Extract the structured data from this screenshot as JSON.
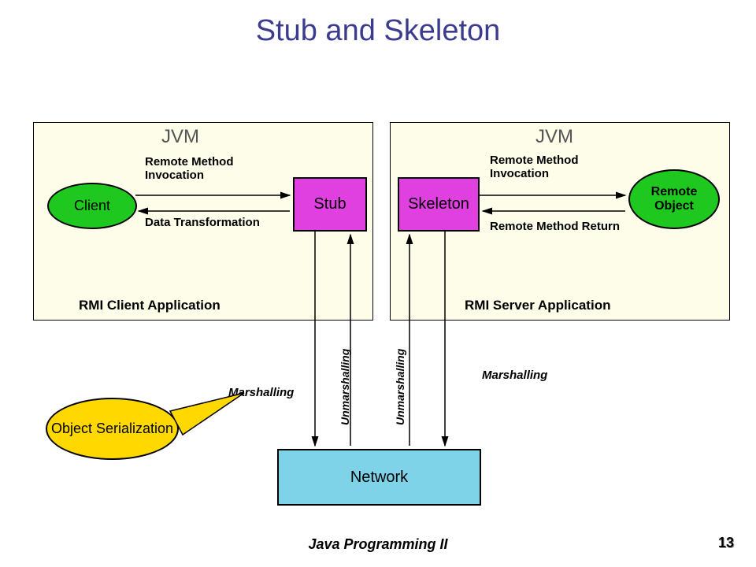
{
  "title": "Stub and Skeleton",
  "left_jvm": {
    "label": "JVM",
    "client": "Client",
    "stub": "Stub",
    "rmi_top": "Remote Method Invocation",
    "rmi_bottom": "Data Transformation",
    "footer": "RMI Client Application"
  },
  "right_jvm": {
    "label": "JVM",
    "skeleton": "Skeleton",
    "remote_object": "Remote Object",
    "rmi_top": "Remote Method Invocation",
    "rmi_bottom": "Remote Method Return",
    "footer": "RMI Server Application"
  },
  "network": "Network",
  "callout": "Object Serialization",
  "marshalling_left": "Marshalling",
  "marshalling_right": "Marshalling",
  "unmarshalling_left": "Unmarshalling",
  "unmarshalling_right": "Unmarshalling",
  "footer_text": "Java Programming II",
  "page_number": "13"
}
